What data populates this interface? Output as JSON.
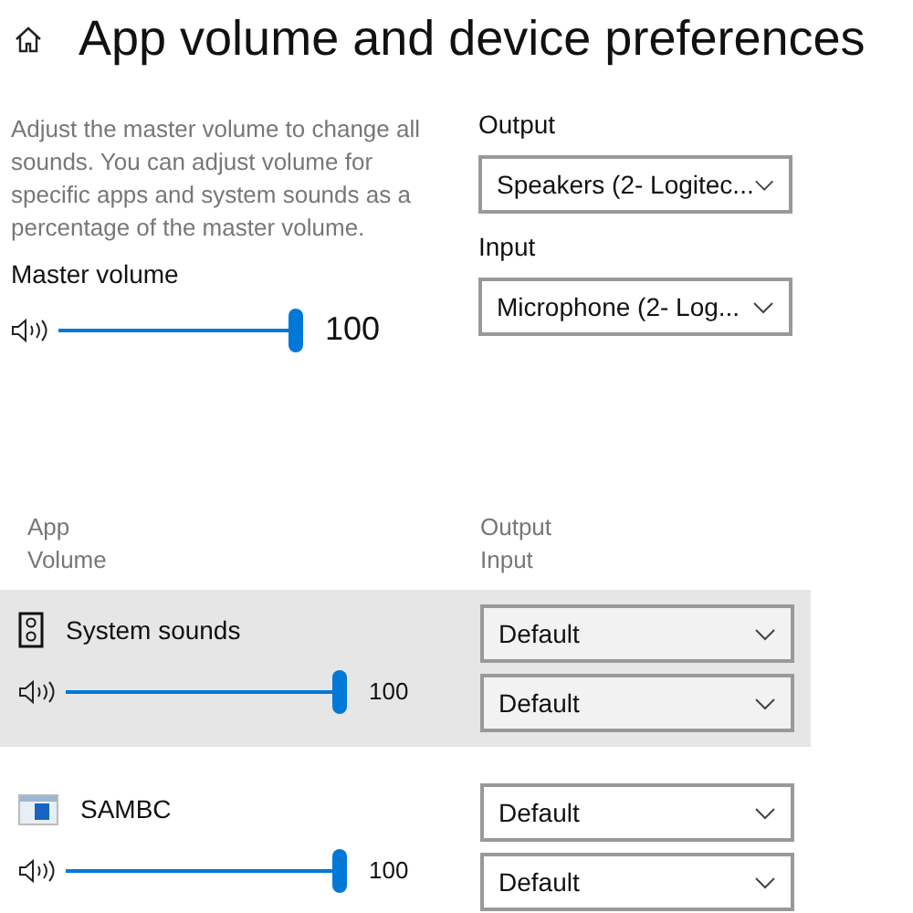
{
  "title": "App volume and device preferences",
  "description": "Adjust the master volume to change all sounds. You can adjust volume for specific apps and system sounds as a percentage of the master volume.",
  "master": {
    "label": "Master volume",
    "level": 1,
    "reading": "100"
  },
  "output": {
    "label": "Output",
    "value": "Speakers (2- Logitec..."
  },
  "input": {
    "label": "Input",
    "value": "Microphone (2- Log..."
  },
  "columns": {
    "app": "App",
    "volume": "Volume",
    "output": "Output",
    "input": "Input"
  },
  "apps": [
    {
      "kind": "system",
      "name": "System sounds",
      "level": 1,
      "reading": "100",
      "output": "Default",
      "input": "Default",
      "selected": true
    },
    {
      "kind": "app",
      "name": "SAMBC",
      "level": 1,
      "reading": "100",
      "output": "Default",
      "input": "Default",
      "selected": false
    }
  ]
}
